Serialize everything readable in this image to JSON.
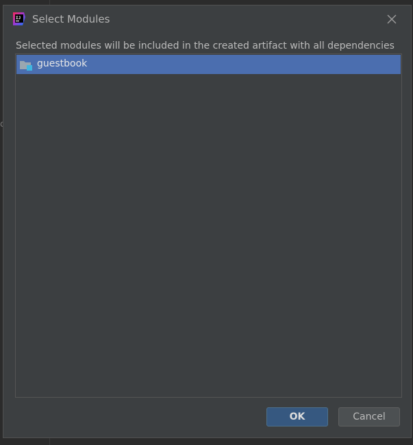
{
  "window": {
    "title": "Select Modules",
    "app_icon": "intellij-idea-icon",
    "close_icon": "close-icon"
  },
  "background": {
    "partial_text": "c"
  },
  "description": "Selected modules will be included in the created artifact with all dependencies",
  "modules": {
    "items": [
      {
        "label": "guestbook",
        "icon": "module-folder-icon",
        "selected": true
      }
    ]
  },
  "buttons": {
    "ok_label": "OK",
    "cancel_label": "Cancel"
  },
  "colors": {
    "dialog_bg": "#3c3f41",
    "selection": "#4b6eaf",
    "ok_button": "#365880",
    "cancel_button": "#4c5052"
  }
}
